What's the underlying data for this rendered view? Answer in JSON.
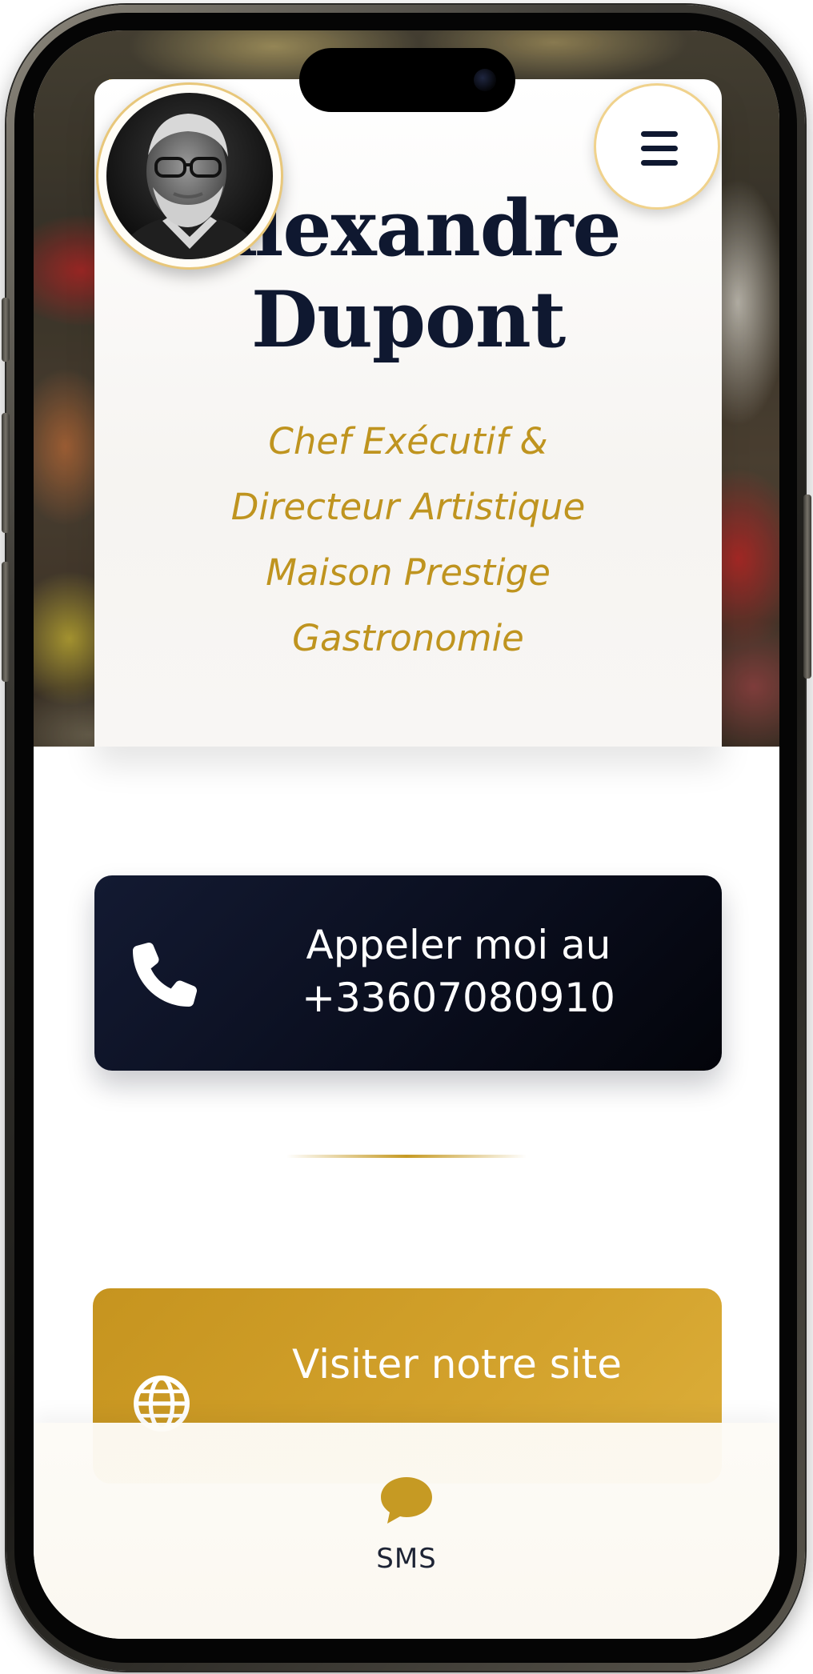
{
  "profile": {
    "name_line1": "Alexandre",
    "name_line2": "Dupont",
    "title_line1": "Chef Exécutif &",
    "title_line2": "Directeur Artistique",
    "title_line3": "Maison Prestige",
    "title_line4": "Gastronomie",
    "avatar_alt": "Portrait"
  },
  "header": {
    "menu_icon": "hamburger-menu-icon"
  },
  "actions": {
    "call_line1": "Appeler moi au",
    "call_line2": "+33607080910",
    "call_icon": "phone-icon",
    "site_label": "Visiter notre site",
    "site_icon": "globe-icon"
  },
  "bottom_bar": {
    "sms_label": "SMS",
    "sms_icon": "chat-bubble-icon"
  },
  "colors": {
    "navy": "#0f1830",
    "gold": "#c69a23",
    "gold_text": "#bf941f",
    "cream": "#fbf8f1"
  }
}
